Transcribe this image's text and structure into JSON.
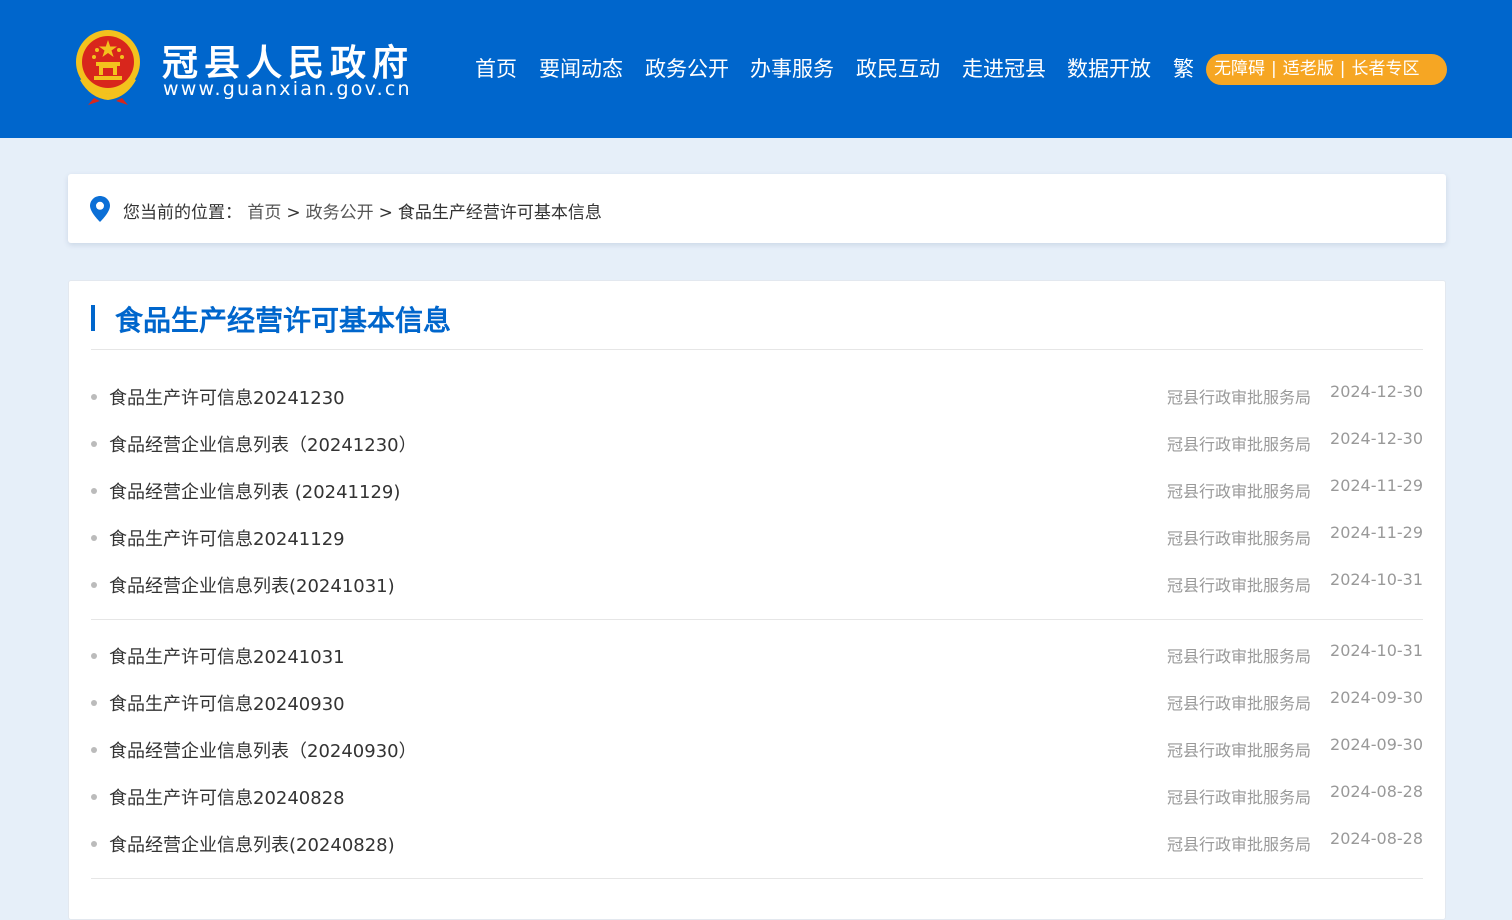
{
  "header": {
    "site_name": "冠县人民政府",
    "site_url": "www.guanxian.gov.cn",
    "nav": [
      "首页",
      "要闻动态",
      "政务公开",
      "办事服务",
      "政民互动",
      "走进冠县",
      "数据开放",
      "繁"
    ],
    "accessibility": [
      "无障碍",
      "适老版",
      "长者专区"
    ],
    "accessibility_separator": "|",
    "colors": {
      "header_bg": "#0066cc",
      "access_bg": "#f6a623"
    }
  },
  "breadcrumb": {
    "prefix": "您当前的位置：",
    "items": [
      "首页",
      "政务公开",
      "食品生产经营许可基本信息"
    ],
    "separator": ">"
  },
  "main": {
    "title": "食品生产经营许可基本信息",
    "items": [
      {
        "title": "食品生产许可信息20241230",
        "source": "冠县行政审批服务局",
        "date": "2024-12-30"
      },
      {
        "title": "食品经营企业信息列表（20241230）",
        "source": "冠县行政审批服务局",
        "date": "2024-12-30"
      },
      {
        "title": "食品经营企业信息列表 (20241129)",
        "source": "冠县行政审批服务局",
        "date": "2024-11-29"
      },
      {
        "title": "食品生产许可信息20241129",
        "source": "冠县行政审批服务局",
        "date": "2024-11-29"
      },
      {
        "title": "食品经营企业信息列表(20241031)",
        "source": "冠县行政审批服务局",
        "date": "2024-10-31"
      },
      {
        "title": "食品生产许可信息20241031",
        "source": "冠县行政审批服务局",
        "date": "2024-10-31"
      },
      {
        "title": "食品生产许可信息20240930",
        "source": "冠县行政审批服务局",
        "date": "2024-09-30"
      },
      {
        "title": "食品经营企业信息列表（20240930）",
        "source": "冠县行政审批服务局",
        "date": "2024-09-30"
      },
      {
        "title": "食品生产许可信息20240828",
        "source": "冠县行政审批服务局",
        "date": "2024-08-28"
      },
      {
        "title": "食品经营企业信息列表(20240828)",
        "source": "冠县行政审批服务局",
        "date": "2024-08-28"
      }
    ]
  }
}
